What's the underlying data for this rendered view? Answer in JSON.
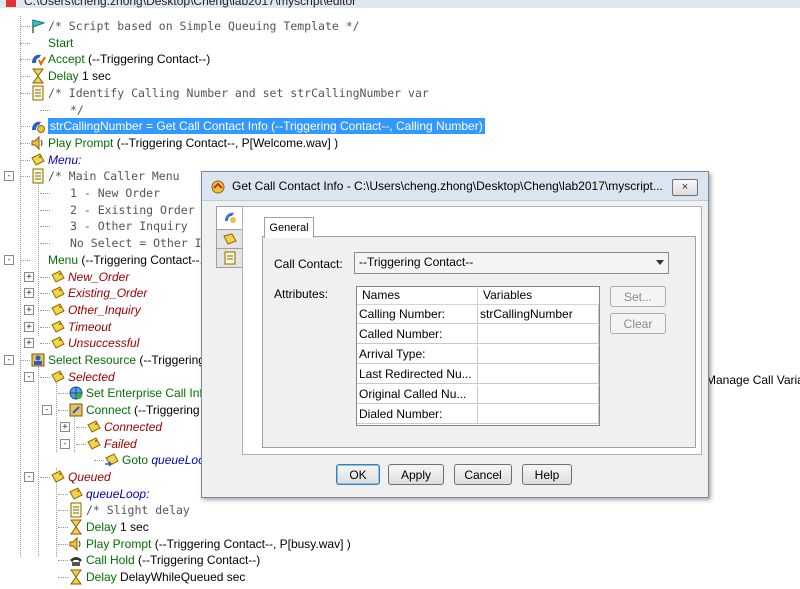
{
  "window": {
    "title": "C:\\Users\\cheng.zhong\\Desktop\\Cheng\\lab2017\\myscript\\editor"
  },
  "tree": [
    {
      "kind": "comment",
      "text": "/* Script based on Simple Queuing Template */",
      "icon": "flag-icon"
    },
    {
      "kind": "step",
      "name": "Start",
      "args": "",
      "icon": ""
    },
    {
      "kind": "step",
      "name": "Accept",
      "args": " (--Triggering Contact--)",
      "icon": "accept-icon"
    },
    {
      "kind": "step",
      "name": "Delay",
      "args": " 1 sec",
      "icon": "hourglass-icon"
    },
    {
      "kind": "comment",
      "text": "/* Identify Calling Number and set strCallingNumber var",
      "icon": "comment-icon"
    },
    {
      "kind": "comment",
      "text": "*/",
      "icon": ""
    },
    {
      "kind": "selected",
      "text": "strCallingNumber = Get Call Contact Info (--Triggering Contact--, Calling Number)",
      "icon": "get-info-icon"
    },
    {
      "kind": "step",
      "name": "Play Prompt",
      "args": " (--Triggering Contact--, P[Welcome.wav] )",
      "icon": "speaker-icon"
    },
    {
      "kind": "label-blue",
      "text": "Menu:",
      "icon": "label-icon"
    },
    {
      "kind": "comment",
      "text": "/* Main Caller Menu",
      "icon": "comment-icon"
    },
    {
      "kind": "comment",
      "text": "1 - New Order",
      "icon": ""
    },
    {
      "kind": "comment",
      "text": "2 - Existing Order",
      "icon": ""
    },
    {
      "kind": "comment",
      "text": "3 - Other Inquiry",
      "icon": ""
    },
    {
      "kind": "comment",
      "text": "No Select = Other I",
      "icon": ""
    },
    {
      "kind": "step",
      "name": "Menu",
      "args": " (--Triggering Contact--, P",
      "icon": ""
    },
    {
      "kind": "label-red",
      "text": "New_Order",
      "icon": "label-icon"
    },
    {
      "kind": "label-red",
      "text": "Existing_Order",
      "icon": "label-icon"
    },
    {
      "kind": "label-red",
      "text": "Other_Inquiry",
      "icon": "label-icon"
    },
    {
      "kind": "label-red",
      "text": "Timeout",
      "icon": "label-icon"
    },
    {
      "kind": "label-red",
      "text": "Unsuccessful",
      "icon": "label-icon"
    },
    {
      "kind": "step",
      "name": "Select Resource",
      "args": " (--Triggering Co",
      "icon": "resource-icon"
    },
    {
      "kind": "label-red",
      "text": "Selected",
      "icon": "label-icon"
    },
    {
      "kind": "step",
      "name": "Set Enterprise Call Info",
      "args": "",
      "icon": "globe-icon"
    },
    {
      "kind": "step",
      "name": "Connect",
      "args": " (--Triggering C",
      "icon": "connect-icon"
    },
    {
      "kind": "label-red",
      "text": "Connected",
      "icon": "label-icon"
    },
    {
      "kind": "label-red",
      "text": "Failed",
      "icon": "label-icon"
    },
    {
      "kind": "goto",
      "name": "Goto",
      "args": " queueLoop",
      "icon": "goto-icon"
    },
    {
      "kind": "label-red",
      "text": "Queued",
      "icon": "label-icon"
    },
    {
      "kind": "label-blue",
      "text": "queueLoop:",
      "icon": "label-icon"
    },
    {
      "kind": "comment",
      "text": "/* Slight delay",
      "icon": "comment-icon"
    },
    {
      "kind": "step",
      "name": "Delay",
      "args": " 1 sec",
      "icon": "hourglass-icon"
    },
    {
      "kind": "step",
      "name": "Play Prompt",
      "args": " (--Triggering Contact--, P[busy.wav] )",
      "icon": "speaker-icon"
    },
    {
      "kind": "step",
      "name": "Call Hold",
      "args": " (--Triggering Contact--)",
      "icon": "phone-icon"
    },
    {
      "kind": "step",
      "name": "Delay",
      "args": " DelayWhileQueued sec",
      "icon": "hourglass-icon"
    }
  ],
  "side_text": "Manage Call Variable",
  "dialog": {
    "title": "Get Call Contact Info - C:\\Users\\cheng.zhong\\Desktop\\Cheng\\lab2017\\myscript...",
    "close": "×",
    "tab": "General",
    "call_contact_label": "Call Contact:",
    "call_contact_value": "--Triggering Contact--",
    "attributes_label": "Attributes:",
    "grid_headers": [
      "Names",
      "Variables"
    ],
    "grid_rows": [
      {
        "name": "Calling Number:",
        "variable": "strCallingNumber"
      },
      {
        "name": "Called Number:",
        "variable": ""
      },
      {
        "name": "Arrival Type:",
        "variable": ""
      },
      {
        "name": "Last Redirected Nu...",
        "variable": ""
      },
      {
        "name": "Original Called Nu...",
        "variable": ""
      },
      {
        "name": "Dialed Number:",
        "variable": ""
      }
    ],
    "set_button": "Set...",
    "clear_button": "Clear",
    "ok_button": "OK",
    "apply_button": "Apply",
    "cancel_button": "Cancel",
    "help_button": "Help"
  },
  "colors": {
    "selection": "#3399ff",
    "step_green": "#007000",
    "label_red": "#a00000",
    "label_blue": "#0000c0"
  }
}
